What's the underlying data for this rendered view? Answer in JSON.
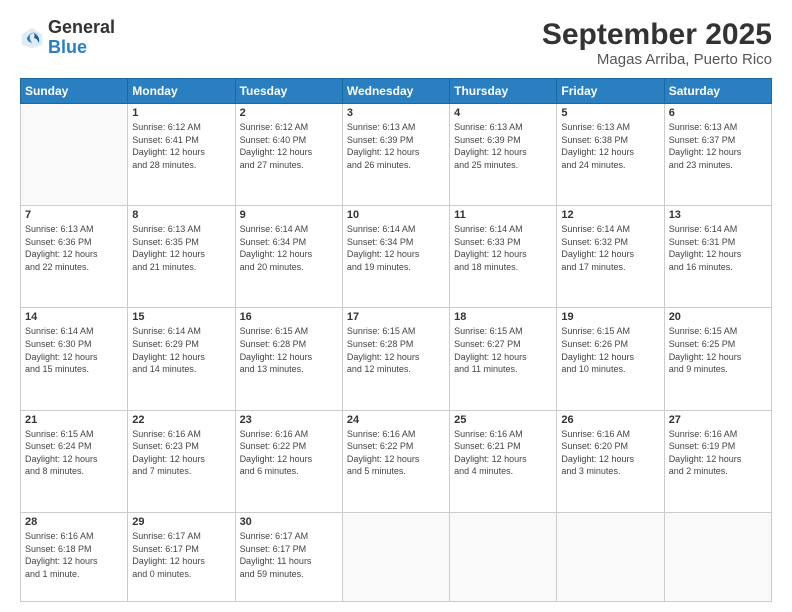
{
  "header": {
    "logo_general": "General",
    "logo_blue": "Blue",
    "title": "September 2025",
    "subtitle": "Magas Arriba, Puerto Rico"
  },
  "calendar": {
    "weekdays": [
      "Sunday",
      "Monday",
      "Tuesday",
      "Wednesday",
      "Thursday",
      "Friday",
      "Saturday"
    ],
    "weeks": [
      [
        {
          "day": "",
          "info": ""
        },
        {
          "day": "1",
          "info": "Sunrise: 6:12 AM\nSunset: 6:41 PM\nDaylight: 12 hours\nand 28 minutes."
        },
        {
          "day": "2",
          "info": "Sunrise: 6:12 AM\nSunset: 6:40 PM\nDaylight: 12 hours\nand 27 minutes."
        },
        {
          "day": "3",
          "info": "Sunrise: 6:13 AM\nSunset: 6:39 PM\nDaylight: 12 hours\nand 26 minutes."
        },
        {
          "day": "4",
          "info": "Sunrise: 6:13 AM\nSunset: 6:39 PM\nDaylight: 12 hours\nand 25 minutes."
        },
        {
          "day": "5",
          "info": "Sunrise: 6:13 AM\nSunset: 6:38 PM\nDaylight: 12 hours\nand 24 minutes."
        },
        {
          "day": "6",
          "info": "Sunrise: 6:13 AM\nSunset: 6:37 PM\nDaylight: 12 hours\nand 23 minutes."
        }
      ],
      [
        {
          "day": "7",
          "info": "Sunrise: 6:13 AM\nSunset: 6:36 PM\nDaylight: 12 hours\nand 22 minutes."
        },
        {
          "day": "8",
          "info": "Sunrise: 6:13 AM\nSunset: 6:35 PM\nDaylight: 12 hours\nand 21 minutes."
        },
        {
          "day": "9",
          "info": "Sunrise: 6:14 AM\nSunset: 6:34 PM\nDaylight: 12 hours\nand 20 minutes."
        },
        {
          "day": "10",
          "info": "Sunrise: 6:14 AM\nSunset: 6:34 PM\nDaylight: 12 hours\nand 19 minutes."
        },
        {
          "day": "11",
          "info": "Sunrise: 6:14 AM\nSunset: 6:33 PM\nDaylight: 12 hours\nand 18 minutes."
        },
        {
          "day": "12",
          "info": "Sunrise: 6:14 AM\nSunset: 6:32 PM\nDaylight: 12 hours\nand 17 minutes."
        },
        {
          "day": "13",
          "info": "Sunrise: 6:14 AM\nSunset: 6:31 PM\nDaylight: 12 hours\nand 16 minutes."
        }
      ],
      [
        {
          "day": "14",
          "info": "Sunrise: 6:14 AM\nSunset: 6:30 PM\nDaylight: 12 hours\nand 15 minutes."
        },
        {
          "day": "15",
          "info": "Sunrise: 6:14 AM\nSunset: 6:29 PM\nDaylight: 12 hours\nand 14 minutes."
        },
        {
          "day": "16",
          "info": "Sunrise: 6:15 AM\nSunset: 6:28 PM\nDaylight: 12 hours\nand 13 minutes."
        },
        {
          "day": "17",
          "info": "Sunrise: 6:15 AM\nSunset: 6:28 PM\nDaylight: 12 hours\nand 12 minutes."
        },
        {
          "day": "18",
          "info": "Sunrise: 6:15 AM\nSunset: 6:27 PM\nDaylight: 12 hours\nand 11 minutes."
        },
        {
          "day": "19",
          "info": "Sunrise: 6:15 AM\nSunset: 6:26 PM\nDaylight: 12 hours\nand 10 minutes."
        },
        {
          "day": "20",
          "info": "Sunrise: 6:15 AM\nSunset: 6:25 PM\nDaylight: 12 hours\nand 9 minutes."
        }
      ],
      [
        {
          "day": "21",
          "info": "Sunrise: 6:15 AM\nSunset: 6:24 PM\nDaylight: 12 hours\nand 8 minutes."
        },
        {
          "day": "22",
          "info": "Sunrise: 6:16 AM\nSunset: 6:23 PM\nDaylight: 12 hours\nand 7 minutes."
        },
        {
          "day": "23",
          "info": "Sunrise: 6:16 AM\nSunset: 6:22 PM\nDaylight: 12 hours\nand 6 minutes."
        },
        {
          "day": "24",
          "info": "Sunrise: 6:16 AM\nSunset: 6:22 PM\nDaylight: 12 hours\nand 5 minutes."
        },
        {
          "day": "25",
          "info": "Sunrise: 6:16 AM\nSunset: 6:21 PM\nDaylight: 12 hours\nand 4 minutes."
        },
        {
          "day": "26",
          "info": "Sunrise: 6:16 AM\nSunset: 6:20 PM\nDaylight: 12 hours\nand 3 minutes."
        },
        {
          "day": "27",
          "info": "Sunrise: 6:16 AM\nSunset: 6:19 PM\nDaylight: 12 hours\nand 2 minutes."
        }
      ],
      [
        {
          "day": "28",
          "info": "Sunrise: 6:16 AM\nSunset: 6:18 PM\nDaylight: 12 hours\nand 1 minute."
        },
        {
          "day": "29",
          "info": "Sunrise: 6:17 AM\nSunset: 6:17 PM\nDaylight: 12 hours\nand 0 minutes."
        },
        {
          "day": "30",
          "info": "Sunrise: 6:17 AM\nSunset: 6:17 PM\nDaylight: 11 hours\nand 59 minutes."
        },
        {
          "day": "",
          "info": ""
        },
        {
          "day": "",
          "info": ""
        },
        {
          "day": "",
          "info": ""
        },
        {
          "day": "",
          "info": ""
        }
      ]
    ]
  }
}
